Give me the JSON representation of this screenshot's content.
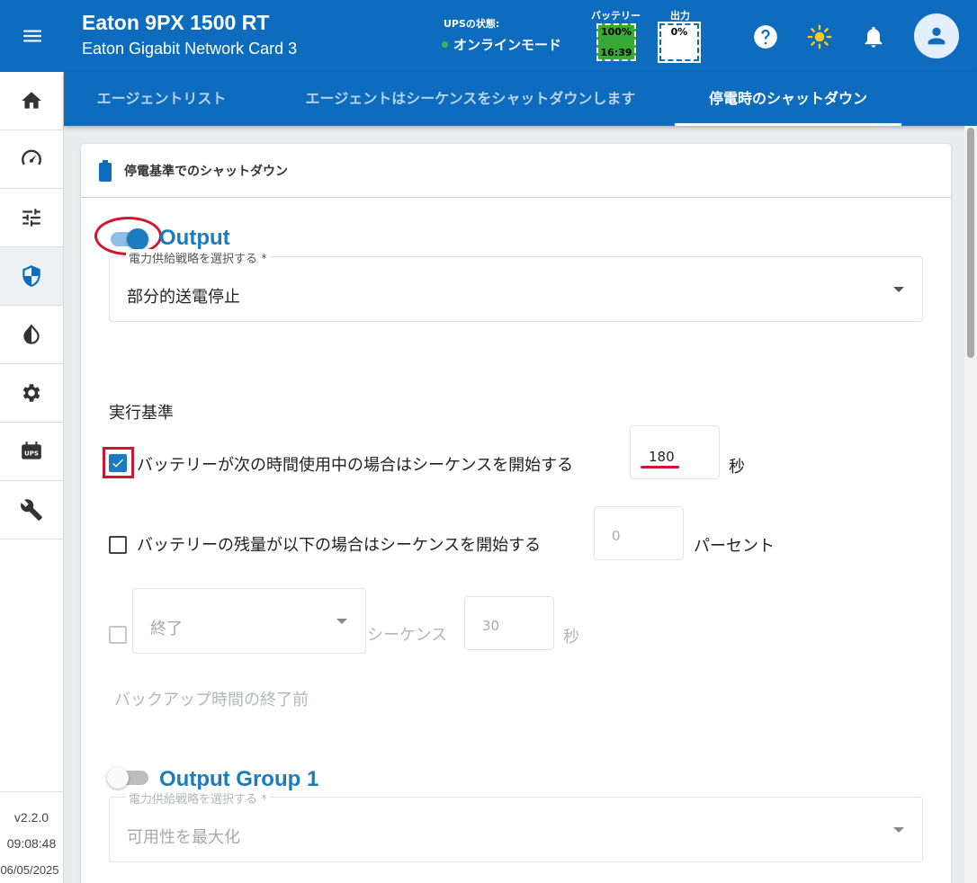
{
  "header": {
    "device_title": "Eaton 9PX 1500 RT",
    "device_subtitle": "Eaton Gigabit Network Card 3",
    "ups_state_label": "UPSの状態:",
    "ups_state_value": "オンラインモード",
    "battery_label": "バッテリー",
    "battery_percent": "100%",
    "battery_time": "16:39",
    "output_label": "出力",
    "output_percent": "0%"
  },
  "tabs": [
    {
      "label": "エージェントリスト"
    },
    {
      "label": "エージェントはシーケンスをシャットダウンします"
    },
    {
      "label": "停電時のシャットダウン"
    }
  ],
  "sidebar": {
    "version": "v2.2.0",
    "time": "09:08:48",
    "date": "06/05/2025"
  },
  "card": {
    "title": "停電基準でのシャットダウン",
    "output": {
      "title": "Output",
      "enabled": true,
      "strategy_label": "電力供給戦略を選択する *",
      "strategy_value": "部分的送電停止"
    },
    "criteria_title": "実行基準",
    "criteria": {
      "battery_time": {
        "checked": true,
        "label": "バッテリーが次の時間使用中の場合はシーケンスを開始する",
        "value": "180",
        "unit": "秒"
      },
      "battery_level": {
        "checked": false,
        "label": "バッテリーの残量が以下の場合はシーケンスを開始する",
        "value": "0",
        "unit": "パーセント"
      },
      "end_sequence": {
        "checked": false,
        "select_value": "終了",
        "label": "シーケンス",
        "value": "30",
        "unit": "秒"
      },
      "backup_note": "バックアップ時間の終了前"
    },
    "output_group_1": {
      "title": "Output Group 1",
      "enabled": false,
      "strategy_label": "電力供給戦略を選択する *",
      "strategy_value": "可用性を最大化"
    }
  },
  "colors": {
    "primary": "#0d6cbd",
    "accent": "#1a7bbf",
    "battery_green": "#39a935",
    "annotation_red": "#d0162e"
  }
}
